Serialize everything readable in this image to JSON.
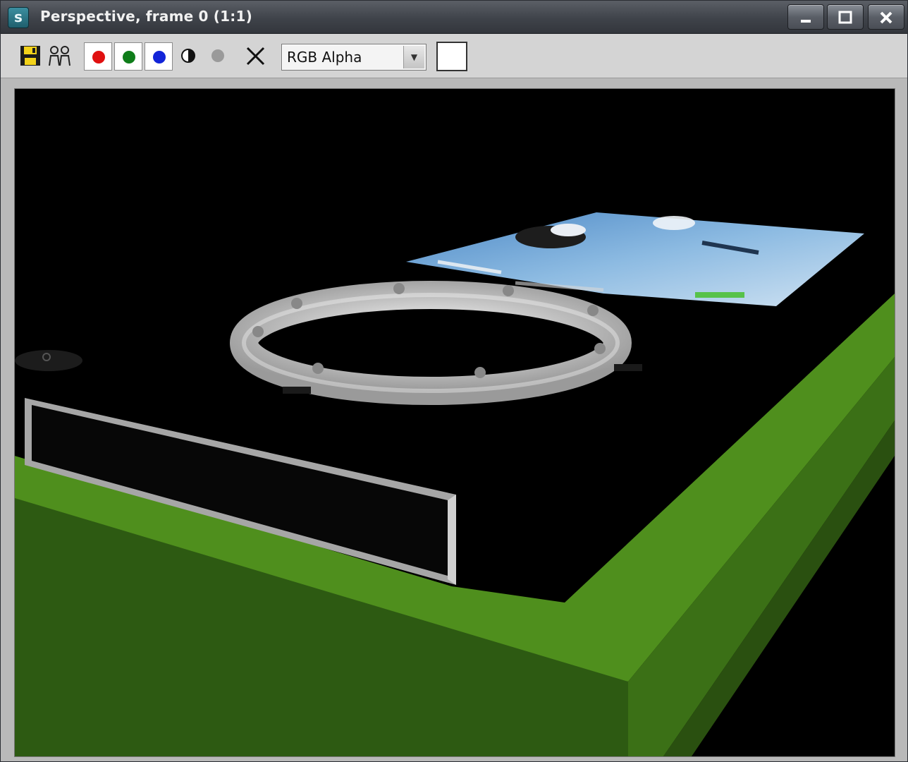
{
  "window": {
    "title": "Perspective, frame 0 (1:1)",
    "app_icon": "s",
    "controls": {
      "minimize_icon": "minimize-icon",
      "maximize_icon": "maximize-icon",
      "close_icon": "close-icon"
    }
  },
  "toolbar": {
    "save_icon": "save-icon",
    "clone_icon": "clone-icon",
    "channels": [
      {
        "name": "red-channel",
        "color": "#e01010"
      },
      {
        "name": "green-channel",
        "color": "#0f7d1a"
      },
      {
        "name": "blue-channel",
        "color": "#1224d8"
      }
    ],
    "mono_icon": "monochrome-icon",
    "alpha_icon": "gray-dot-icon",
    "clear_icon": "clear-x-icon",
    "display_mode": {
      "value": "RGB Alpha"
    },
    "color_swatch": "#ffffff"
  },
  "viewport": {
    "background": "#000000",
    "colors": {
      "board_top": "#4f8f1d",
      "board_side": "#2f5a12",
      "screen": "#6fa6d6",
      "ring": "#e6e6e6",
      "plate_frame": "#a8a8a8"
    }
  }
}
